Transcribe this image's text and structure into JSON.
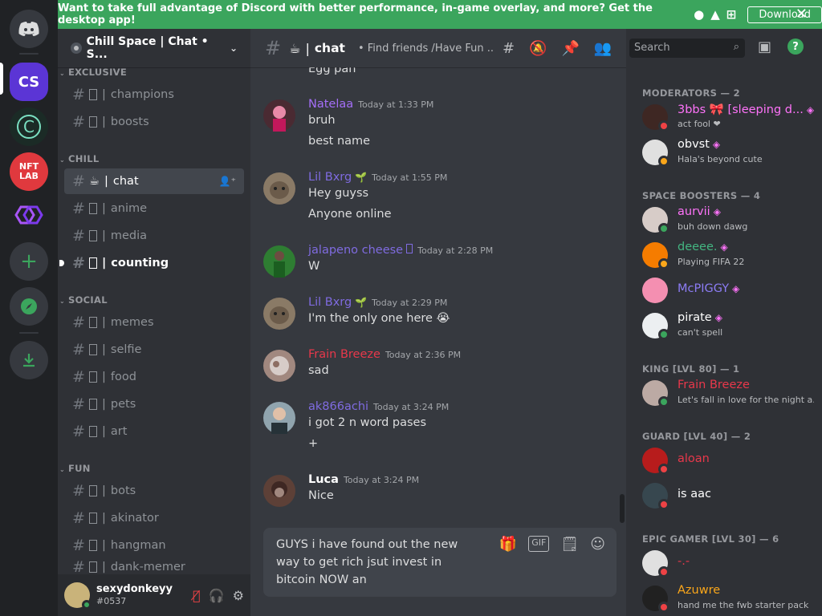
{
  "banner": {
    "text": "Want to take full advantage of Discord with better performance, in-game overlay, and more? Get the desktop app!",
    "download_label": "Download"
  },
  "rail": {
    "servers": [
      {
        "name": "home-button",
        "label": ""
      },
      {
        "name": "server-chill-space",
        "label": "CS"
      },
      {
        "name": "server-circle",
        "label": "C"
      },
      {
        "name": "server-nft-lab",
        "label": "NFT LAB"
      },
      {
        "name": "server-link",
        "label": ""
      }
    ]
  },
  "server": {
    "name": "Chill Space | Chat • S...",
    "categories": {
      "exclusive": "EXCLUSIVE",
      "chill": "CHILL",
      "social": "SOCIAL",
      "fun": "FUN"
    },
    "channels": {
      "champions": "champions",
      "boosts": "boosts",
      "chat": "chat",
      "anime": "anime",
      "media": "media",
      "counting": "counting",
      "memes": "memes",
      "selfie": "selfie",
      "food": "food",
      "pets": "pets",
      "art": "art",
      "bots": "bots",
      "akinator": "akinator",
      "hangman": "hangman",
      "dank_memer": "dank-memer"
    }
  },
  "user": {
    "name": "sexydonkeyy",
    "tag": "#0537"
  },
  "chat": {
    "channel": "chat",
    "topic": "• Find friends /Have Fun ...",
    "search_placeholder": "Search",
    "top_line": "Egg pan",
    "messages": [
      {
        "author": "Natelaa",
        "color": "#a46ef8",
        "time": "Today at 1:33 PM",
        "lines": [
          "bruh",
          "best name"
        ]
      },
      {
        "author": "Lil Bxrg",
        "color": "#7f6be0",
        "time": "Today at 1:55 PM",
        "lines": [
          "Hey guyss",
          "Anyone online"
        ]
      },
      {
        "author": "jalapeno cheese",
        "color": "#7f6be0",
        "time": "Today at 2:28 PM",
        "lines": [
          "W"
        ]
      },
      {
        "author": "Lil Bxrg",
        "color": "#7f6be0",
        "time": "Today at 2:29 PM",
        "lines": [
          "I'm the only one here 😭"
        ]
      },
      {
        "author": "Frain Breeze",
        "color": "#e8384b",
        "time": "Today at 2:36 PM",
        "lines": [
          "sad"
        ]
      },
      {
        "author": "ak866achi",
        "color": "#7f6be0",
        "time": "Today at 3:24 PM",
        "lines": [
          "i got 2 n word pases",
          "+"
        ]
      },
      {
        "author": "Luca",
        "color": "#ffffff",
        "time": "Today at 3:24 PM",
        "lines": [
          "Nice"
        ]
      }
    ],
    "composer_text": "GUYS i have found out the new way to get rich jsut invest in bitcoin NOW an"
  },
  "members": {
    "groups": {
      "moderators": "MODERATORS — 2",
      "space_boosters": "SPACE BOOSTERS — 4",
      "king": "KING [LVL 80] — 1",
      "guard": "GUARD [LVL 40] — 2",
      "epic_gamer": "EPIC GAMER [LVL 30] — 6"
    },
    "list": {
      "m1": {
        "name": "3bbs 🎀 [sleeping d...",
        "status": "act fool ❤",
        "color": "#ff73fa"
      },
      "m2": {
        "name": "obvst",
        "status": "Hala's beyond cute",
        "color": "#ffffff"
      },
      "m3": {
        "name": "aurvii",
        "status": "buh down dawg",
        "color": "#ff73fa"
      },
      "m4": {
        "name": "deeee.",
        "status": "Playing FIFA 22",
        "color": "#43b581"
      },
      "m5": {
        "name": "McPIGGY",
        "status": "",
        "color": "#8c7cf5"
      },
      "m6": {
        "name": "pirate",
        "status": "can't spell",
        "color": "#ffffff"
      },
      "m7": {
        "name": "Frain Breeze",
        "status": "Let's fall in love for the night a...",
        "color": "#e8384b"
      },
      "m8": {
        "name": "aloan",
        "status": "",
        "color": "#e8384b"
      },
      "m9": {
        "name": "is aac",
        "status": "",
        "color": "#ffffff"
      },
      "m10": {
        "name": "-.-",
        "status": "",
        "color": "#e8384b"
      },
      "m11": {
        "name": "Azuwre",
        "status": "hand me the fwb starter pack",
        "color": "#faa61a"
      }
    }
  },
  "colors": {
    "banner_green": "#3ba55d",
    "brand": "#5865f2",
    "online": "#3ba55d",
    "dnd": "#ed4245",
    "idle": "#faa61a"
  }
}
